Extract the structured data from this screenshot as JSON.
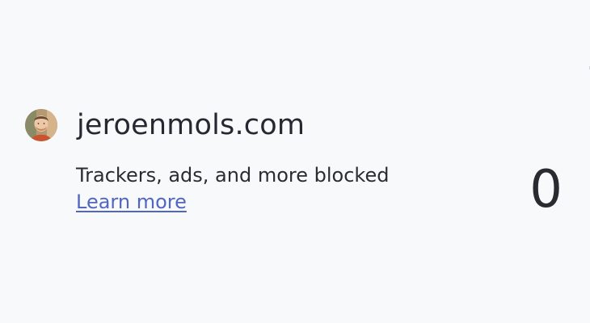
{
  "site": {
    "favicon_icon": "avatar-photo-icon",
    "name": "jeroenmols.com"
  },
  "privacy": {
    "blocked_label": "Trackers, ads, and more blocked",
    "learn_more": "Learn more",
    "blocked_count": "0"
  },
  "colors": {
    "background": "#f8f9fb",
    "text": "#2a2b30",
    "link": "#5166c3"
  }
}
